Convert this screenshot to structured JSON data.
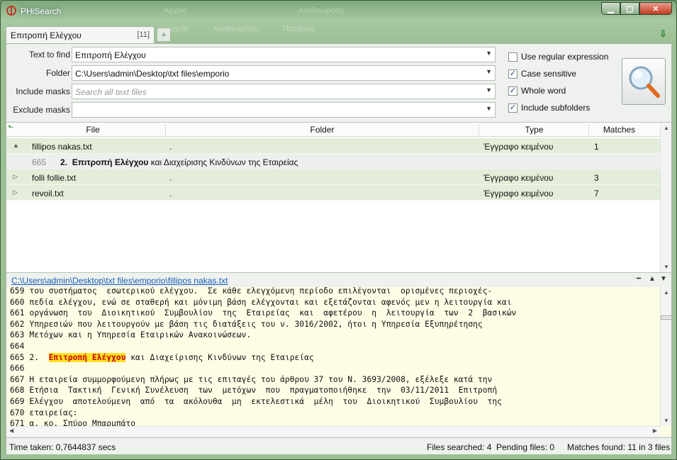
{
  "window": {
    "title": "PHiSearch",
    "ghost_menu": [
      "Αρχείο",
      "Αναθεώρηση",
      "Προβολή"
    ]
  },
  "tab": {
    "label": "Επιτροπή Ελέγχου",
    "count": "[11]",
    "add_symbol": "+"
  },
  "form": {
    "text_to_find": {
      "label": "Text to find",
      "value": "Επιτροπή Ελέγχου"
    },
    "folder": {
      "label": "Folder",
      "value": "C:\\Users\\admin\\Desktop\\txt files\\emporio"
    },
    "include_masks": {
      "label": "Include masks",
      "placeholder": "Search all text files"
    },
    "exclude_masks": {
      "label": "Exclude masks",
      "value": ""
    }
  },
  "options": [
    {
      "label": "Use regular expression",
      "checked": false
    },
    {
      "label": "Case sensitive",
      "checked": true
    },
    {
      "label": "Whole word",
      "checked": true
    },
    {
      "label": "Include subfolders",
      "checked": true
    }
  ],
  "results": {
    "columns": [
      "File",
      "Folder",
      "Type",
      "Matches"
    ],
    "rows": [
      {
        "file": "fillipos nakas.txt",
        "folder": ".",
        "type": "Έγγραφο κειμένου",
        "matches": "1",
        "expanded": true,
        "sub": {
          "line": "665",
          "prefix": "2.  ",
          "match": "Επιτροπή Ελέγχου",
          "rest": " και Διαχείρισης Κινδύνων της Εταιρείας"
        }
      },
      {
        "file": "folli follie.txt",
        "folder": ".",
        "type": "Έγγραφο κειμένου",
        "matches": "3",
        "expanded": false
      },
      {
        "file": "revoil.txt",
        "folder": ".",
        "type": "Έγγραφο κειμένου",
        "matches": "7",
        "expanded": false
      }
    ]
  },
  "preview": {
    "path_parts": [
      "C:\\Users\\admin\\Desktop\\txt files\\emporio",
      "\\",
      "fillipos nakas.txt"
    ],
    "lines": [
      {
        "n": "659",
        "t": "του συστήματος  εσωτερικού ελέγχου.  Σε κάθε ελεγχόμενη περίοδο επιλέγονται  ορισμένες περιοχές-"
      },
      {
        "n": "660",
        "t": "πεδία ελέγχου, ενώ σε σταθερή και μόνιμη βάση ελέγχονται και εξετάζονται αφενός μεν η λειτουργία και"
      },
      {
        "n": "661",
        "t": "οργάνωση  του  Διοικητικού  Συμβουλίου  της  Εταιρείας  και  αφετέρου  η  λειτουργία  των  2  βασικών"
      },
      {
        "n": "662",
        "t": "Υπηρεσιών που λειτουργούν με βάση τις διατάξεις του ν. 3016/2002, ήτοι η Υπηρεσία Εξυπηρέτησης"
      },
      {
        "n": "663",
        "t": "Μετόχων και η Υπηρεσία Εταιρικών Ανακοινώσεων."
      },
      {
        "n": "664",
        "t": ""
      },
      {
        "n": "665",
        "t": "2.  ",
        "match": "Επιτροπή Ελέγχου",
        "rest": " και Διαχείρισης Κινδύνων της Εταιρείας"
      },
      {
        "n": "666",
        "t": ""
      },
      {
        "n": "667",
        "t": "Η εταιρεία συμμορφούμενη πλήρως με τις επιταγές του άρθρου 37 του Ν. 3693/2008, εξέλεξε κατά την"
      },
      {
        "n": "668",
        "t": "Ετήσια  Τακτική  Γενική Συνέλευση  των  μετόχων  που  πραγματοποιήθηκε  την  03/11/2011  Επιτροπή"
      },
      {
        "n": "669",
        "t": "Ελέγχου  αποτελούμενη  από  τα  ακόλουθα  μη  εκτελεστικά  μέλη  του  Διοικητικού  Συμβουλίου  της"
      },
      {
        "n": "670",
        "t": "εταιρείας:"
      },
      {
        "n": "671",
        "t": "α. κο. Σπύρο Μπαρμπάτο"
      }
    ]
  },
  "status": {
    "time_taken": "Time taken: 0,7644837 secs",
    "files_searched": "Files searched: 4",
    "pending_files": "Pending files: 0",
    "matches_found": "Matches found: 11 in 3 files"
  },
  "colors": {
    "accent_match_bg": "#ffe21f",
    "accent_match_fg": "#d10000",
    "row_bg": "#e4edd9",
    "preview_bg": "#fdfde6"
  }
}
